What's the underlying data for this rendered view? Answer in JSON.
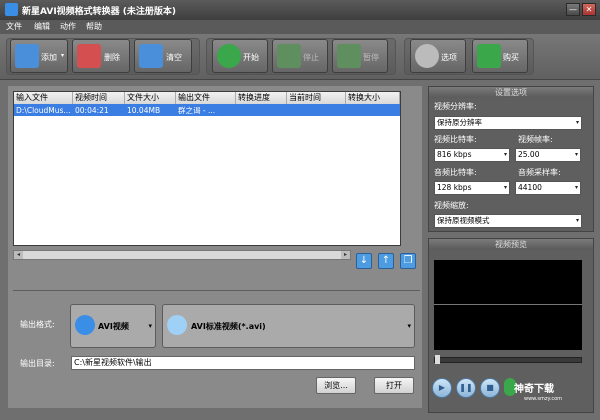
{
  "window": {
    "title": "新星AVI视频格式转换器 (未注册版本)",
    "minimize": "—",
    "close": "✕"
  },
  "menu": [
    "文件",
    "编辑",
    "动作",
    "帮助"
  ],
  "toolbar": {
    "add": "添加",
    "delete": "删除",
    "clear": "清空",
    "start": "开始",
    "stop": "停止",
    "pause": "暂停",
    "options": "选项",
    "buy": "购买"
  },
  "table": {
    "headers": [
      "输入文件",
      "视频时间",
      "文件大小",
      "输出文件",
      "转换进度",
      "当前时间",
      "转换大小"
    ],
    "rows": [
      [
        "D:\\CloudMus...",
        "00:04:21",
        "10.04MB",
        "群之谒 - ...",
        "",
        "",
        ""
      ]
    ]
  },
  "output": {
    "format_label": "输出格式:",
    "format_name": "AVI视频",
    "format_desc": "AVI标准视频(*.avi)",
    "dir_label": "输出目录:",
    "dir_value": "C:\\新星视频软件\\输出",
    "browse": "浏览...",
    "open": "打开"
  },
  "settings": {
    "header": "设置选项",
    "resolution_label": "视频分辨率:",
    "resolution_value": "保持原分辨率",
    "vbitrate_label": "视频比特率:",
    "vbitrate_value": "816 kbps",
    "fps_label": "视频帧率:",
    "fps_value": "25.00",
    "abitrate_label": "音频比特率:",
    "abitrate_value": "128 kbps",
    "samplerate_label": "音频采样率:",
    "samplerate_value": "44100",
    "scale_label": "视频缩放:",
    "scale_value": "保持原视频模式"
  },
  "preview": {
    "header": "视频预览"
  },
  "watermark": {
    "name": "神奇下载",
    "url": "www.smzy.com"
  }
}
